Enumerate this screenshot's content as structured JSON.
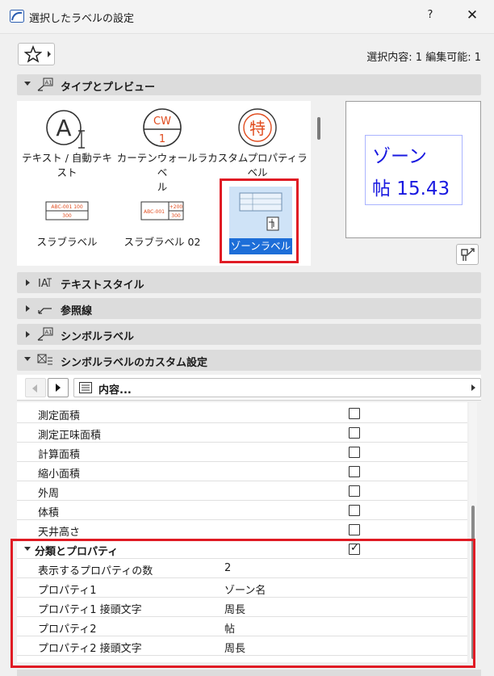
{
  "window": {
    "title": "選択したラベルの設定",
    "help_label": "?",
    "close_label": "✕"
  },
  "selection_info": "選択内容: 1 編集可能: 1",
  "sections": {
    "type_preview": "タイプとプレビュー",
    "text_style": "テキストスタイル",
    "leader": "参照線",
    "symbol_label": "シンボルラベル",
    "custom_settings": "シンボルラベルのカスタム設定"
  },
  "label_types": {
    "text_auto": {
      "caption_line1": "テキスト / 自動テキ",
      "caption_line2": "スト",
      "glyph": "A"
    },
    "curtain_wall": {
      "caption_line1": "カーテンウォールラベ",
      "caption_line2": "ル",
      "glyph_top": "CW",
      "glyph_bottom": "1"
    },
    "custom_property": {
      "caption_line1": "カスタムプロパティラ",
      "caption_line2": "ベル",
      "glyph": "特"
    },
    "slab": {
      "caption": "スラブラベル",
      "glyph_text": "ABC-001 100",
      "glyph_sub": "300"
    },
    "slab_02": {
      "caption": "スラブラベル 02",
      "glyph_text": "ABC-001",
      "glyph_right": "+200",
      "glyph_sub": "300"
    },
    "zone": {
      "caption": "ゾーンラベル",
      "selected": true
    }
  },
  "preview": {
    "line1": "ゾーン",
    "line2": "帖  15.43"
  },
  "content_dropdown": {
    "label": "内容..."
  },
  "area_rows": [
    {
      "name": "測定面積",
      "checked": false
    },
    {
      "name": "測定正味面積",
      "checked": false
    },
    {
      "name": "計算面積",
      "checked": false
    },
    {
      "name": "縮小面積",
      "checked": false
    },
    {
      "name": "外周",
      "checked": false
    },
    {
      "name": "体積",
      "checked": false
    },
    {
      "name": "天井高さ",
      "checked": false
    }
  ],
  "properties": {
    "group_label": "分類とプロパティ",
    "group_checked": true,
    "rows": [
      {
        "name": "表示するプロパティの数",
        "value": "2"
      },
      {
        "name": "プロパティ1",
        "value": "ゾーン名"
      },
      {
        "name": "プロパティ1 接頭文字",
        "value": "周長"
      },
      {
        "name": "プロパティ2",
        "value": "帖"
      },
      {
        "name": "プロパティ2 接頭文字",
        "value": "周長"
      }
    ]
  },
  "colors": {
    "highlight": "#e01b24",
    "selection_blue": "#1d6ed8",
    "preview_text": "#1818e0",
    "icon_orange": "#e04a1c"
  }
}
